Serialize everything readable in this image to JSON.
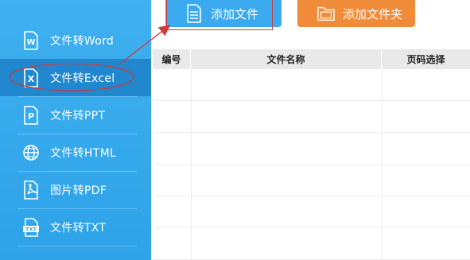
{
  "sidebar": {
    "items": [
      {
        "label": "文件转Word",
        "icon": "word-icon"
      },
      {
        "label": "文件转Excel",
        "icon": "excel-icon"
      },
      {
        "label": "文件转PPT",
        "icon": "ppt-icon"
      },
      {
        "label": "文件转HTML",
        "icon": "globe-icon"
      },
      {
        "label": "图片转PDF",
        "icon": "pdf-icon"
      },
      {
        "label": "文件转TXT",
        "icon": "txt-icon"
      }
    ],
    "active_index": 1
  },
  "toolbar": {
    "add_file_label": "添加文件",
    "add_folder_label": "添加文件夹"
  },
  "table": {
    "columns": [
      "编号",
      "文件名称",
      "页码选择"
    ],
    "rows": []
  },
  "colors": {
    "sidebar_bg": "#3fb0f0",
    "sidebar_active": "#2188cf",
    "add_file_btn": "#3aa9ee",
    "add_folder_btn": "#f08c39",
    "annotation_red": "#d43838"
  }
}
